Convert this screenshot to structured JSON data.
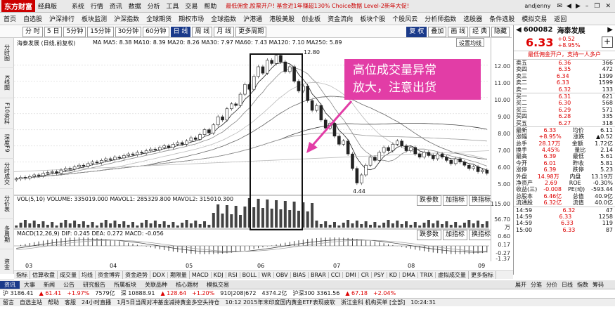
{
  "titlebar": {
    "logo": "东方财富",
    "edition": "经典版",
    "menus": [
      "系统",
      "行情",
      "资讯",
      "数据",
      "分析",
      "工具",
      "交易",
      "帮助"
    ],
    "ticker": "最低佣金,股票开户! 基金近1年赚超130% Choice数据 Level-2新年大促!",
    "user": "andjenny"
  },
  "navbar": {
    "items": [
      "首页",
      "自选股",
      "沪深排行",
      "板块监测",
      "沪深指数",
      "全球期货",
      "期权市场",
      "全球指数",
      "沪港通",
      "港股美股",
      "创业板",
      "资金流向",
      "板块个股",
      "个股风云",
      "分析师指数",
      "选股器",
      "条件选股",
      "模拟交易",
      "返回"
    ]
  },
  "ctrl": {
    "periods": [
      "分 时",
      "5 日",
      "5分钟",
      "15分钟",
      "30分钟",
      "60分钟",
      "日 线",
      "周 线",
      "月 线",
      "更多周期"
    ],
    "active": "日 线",
    "tools": [
      "复 权",
      "叠加",
      "画 线",
      "经 典",
      "隐藏"
    ]
  },
  "side": [
    "分时图",
    "K线图",
    "F10资料",
    "深度F9",
    "分时成交",
    "分价表",
    "多周期",
    "资金",
    "席位"
  ],
  "chart": {
    "title": "海泰发展 (日线,前复权)",
    "ma_line": "MA  MA5: 8.38  MA10: 8.39  MA20: 8.26  MA30: 7.97  MA60: 7.43  MA120: 7.10  MA250: 5.89",
    "setting": "设置均线",
    "high_label": "12.80",
    "low_label": "4.44",
    "price_axis": [
      "12.00",
      "11.00",
      "10.00",
      "9.00",
      "8.00",
      "7.00",
      "6.00",
      "5.00"
    ],
    "vol_line": "VOL(5,10) VOLUME: 335019.000  MAVOL1: 285329.800  MAVOL2: 315010.300",
    "vol_axis": [
      "115.00",
      "56.70",
      "万"
    ],
    "macd_line": "MACD(12,26,9)  DIF: 0.245  DEA: 0.272  MACD: -0.056",
    "macd_axis": [
      "0.60",
      "0.17",
      "-0.27",
      "-1.37"
    ],
    "macd_lower_axis": "x0.1",
    "buttons": [
      "跌参数",
      "加指标",
      "换指标"
    ],
    "dates": [
      "03",
      "04",
      "05",
      "06",
      "07",
      "08",
      "09"
    ],
    "chart_data": {
      "type": "candlestick",
      "title": "海泰发展 (日线,前复权)",
      "ylim": [
        4.2,
        12.9
      ],
      "series_ma": [
        "MA5",
        "MA10",
        "MA20",
        "MA30",
        "MA60",
        "MA120",
        "MA250"
      ],
      "annotations": [
        "12.80",
        "4.44"
      ],
      "candles": [
        [
          4.9,
          4.95
        ],
        [
          4.95,
          5.05
        ],
        [
          5.05,
          5.0
        ],
        [
          5.0,
          5.1
        ],
        [
          5.1,
          5.2
        ],
        [
          5.2,
          5.15
        ],
        [
          5.15,
          5.3
        ],
        [
          5.3,
          5.35
        ],
        [
          5.35,
          5.4
        ],
        [
          5.4,
          5.3
        ],
        [
          5.3,
          5.5
        ],
        [
          5.5,
          5.6
        ],
        [
          5.6,
          5.55
        ],
        [
          5.55,
          5.7
        ],
        [
          5.7,
          5.8
        ],
        [
          5.8,
          5.75
        ],
        [
          5.75,
          5.9
        ],
        [
          5.9,
          6.0
        ],
        [
          6.0,
          5.95
        ],
        [
          5.95,
          6.1
        ],
        [
          6.1,
          6.2
        ],
        [
          6.2,
          6.15
        ],
        [
          6.15,
          6.3
        ],
        [
          6.3,
          6.25
        ],
        [
          6.25,
          6.4
        ],
        [
          6.4,
          6.5
        ],
        [
          6.5,
          6.45
        ],
        [
          6.45,
          6.6
        ],
        [
          6.6,
          6.55
        ],
        [
          6.55,
          6.7
        ],
        [
          6.7,
          6.8
        ],
        [
          6.8,
          6.75
        ],
        [
          6.75,
          6.9
        ],
        [
          6.9,
          7.0
        ],
        [
          7.0,
          6.9
        ],
        [
          6.9,
          7.1
        ],
        [
          7.1,
          7.2
        ],
        [
          7.2,
          7.1
        ],
        [
          7.1,
          7.3
        ],
        [
          7.3,
          7.5
        ],
        [
          7.5,
          7.4
        ],
        [
          7.4,
          7.7
        ],
        [
          7.7,
          8.0
        ],
        [
          8.0,
          7.8
        ],
        [
          7.8,
          8.3
        ],
        [
          8.3,
          8.8
        ],
        [
          8.8,
          8.6
        ],
        [
          8.6,
          9.3
        ],
        [
          9.3,
          9.6
        ],
        [
          9.6,
          9.5
        ],
        [
          9.5,
          10.2
        ],
        [
          10.2,
          10.8
        ],
        [
          10.8,
          10.5
        ],
        [
          10.5,
          11.3
        ],
        [
          11.3,
          11.9
        ],
        [
          11.9,
          11.5
        ],
        [
          11.5,
          12.3
        ],
        [
          12.3,
          12.1
        ],
        [
          12.1,
          12.6
        ],
        [
          12.6,
          12.2
        ],
        [
          12.2,
          11.6
        ],
        [
          11.6,
          11.9
        ],
        [
          11.9,
          11.0
        ],
        [
          11.0,
          10.4
        ],
        [
          10.4,
          10.7
        ],
        [
          10.7,
          9.8
        ],
        [
          9.8,
          9.2
        ],
        [
          9.2,
          9.5
        ],
        [
          9.5,
          8.6
        ],
        [
          8.6,
          8.1
        ],
        [
          8.1,
          8.4
        ],
        [
          8.4,
          7.6
        ],
        [
          7.6,
          7.1
        ],
        [
          7.1,
          7.3
        ],
        [
          7.3,
          6.5
        ],
        [
          6.5,
          5.6
        ],
        [
          5.6,
          4.7
        ],
        [
          4.7,
          5.2
        ],
        [
          5.2,
          5.8
        ],
        [
          5.8,
          6.3
        ],
        [
          6.3,
          6.1
        ],
        [
          6.1,
          6.6
        ],
        [
          6.6,
          6.9
        ],
        [
          6.9,
          6.7
        ],
        [
          6.7,
          7.1
        ],
        [
          7.1,
          7.3
        ],
        [
          7.3,
          7.0
        ],
        [
          7.0,
          6.7
        ],
        [
          6.7,
          6.9
        ],
        [
          6.9,
          6.5
        ],
        [
          6.5,
          6.3
        ],
        [
          6.3,
          6.6
        ],
        [
          6.6,
          6.4
        ],
        [
          6.4,
          6.2
        ],
        [
          6.2,
          6.5
        ],
        [
          6.5,
          6.3
        ],
        [
          6.3,
          6.1
        ],
        [
          6.1,
          5.9
        ],
        [
          5.9,
          6.2
        ],
        [
          6.2,
          6.0
        ],
        [
          6.0,
          5.8
        ],
        [
          5.8,
          5.6
        ],
        [
          5.6,
          5.7
        ],
        [
          5.7,
          5.4
        ],
        [
          5.4,
          5.5
        ],
        [
          5.5,
          5.3
        ]
      ]
    }
  },
  "callout": [
    "高位成交量异常",
    "放大，注意出货"
  ],
  "quote": {
    "code": "600082",
    "name": "海泰发展",
    "price": "6.33",
    "change": "+0.52",
    "pct": "+8.95%",
    "ad": "最低佣金开户，支持一人多户",
    "sell": [
      [
        "卖五",
        "6.36",
        "366"
      ],
      [
        "卖四",
        "6.35",
        "472"
      ],
      [
        "卖三",
        "6.34",
        "1399"
      ],
      [
        "卖二",
        "6.33",
        "1599"
      ],
      [
        "卖一",
        "6.32",
        "133",
        "+133"
      ]
    ],
    "buy": [
      [
        "买一",
        "6.31",
        "621",
        "+621"
      ],
      [
        "买二",
        "6.30",
        "568"
      ],
      [
        "买三",
        "6.29",
        "571"
      ],
      [
        "买四",
        "6.28",
        "335"
      ],
      [
        "买五",
        "6.27",
        "318"
      ]
    ],
    "stats": [
      [
        "最新",
        "6.33",
        "均价",
        "6.11"
      ],
      [
        "涨幅",
        "+8.95%",
        "涨跌",
        "▲0.52"
      ],
      [
        "总手",
        "28.17万",
        "金额",
        "1.72亿"
      ],
      [
        "换手",
        "4.45%",
        "量比",
        "2.14"
      ],
      [
        "最高",
        "6.39",
        "最低",
        "5.61"
      ],
      [
        "今开",
        "6.01",
        "昨收",
        "5.81"
      ],
      [
        "涨停",
        "6.39",
        "跌停",
        "5.23"
      ],
      [
        "外盘",
        "14.98万",
        "内盘",
        "13.19万"
      ],
      [
        "净资产",
        "2.69",
        "ROE",
        "-0.30%"
      ],
      [
        "收益(三)",
        "-0.008",
        "PE(动)",
        "-593.44"
      ],
      [
        "总股本",
        "6.46亿",
        "总值",
        "40.9亿"
      ],
      [
        "流通股",
        "6.32亿",
        "流值",
        "40.0亿"
      ]
    ],
    "ticks": [
      [
        "14:59",
        "6.32",
        "47"
      ],
      [
        "14:59",
        "6.33",
        "1258"
      ],
      [
        "14:59",
        "6.33",
        "119"
      ],
      [
        "15:00",
        "6.33",
        "87"
      ]
    ]
  },
  "tabs1": [
    "指标",
    "估算收盘",
    "成交量",
    "均线",
    "资金博弈",
    "资金趋势",
    "DDX",
    "期限量",
    "MACD",
    "KDJ",
    "RSI",
    "BOLL",
    "WR",
    "OBV",
    "BIAS",
    "BRAR",
    "CCI",
    "DMI",
    "CR",
    "PSY",
    "KD",
    "DMA",
    "TRIX",
    "虚拟成交量",
    "更多指标"
  ],
  "tabs2": [
    "资讯",
    "大事",
    "新闻",
    "公告",
    "研究报告",
    "所属板块",
    "关联品种",
    "核心题材",
    "模拟交易"
  ],
  "rtabs": [
    "展开",
    "分笔",
    "分价",
    "日线",
    "指数",
    "筹码"
  ],
  "idx": [
    "沪 3186.41",
    "▲ 61.41",
    "+1.97%",
    "7579亿",
    "深 10888.91",
    "▲ 128.64",
    "+1.20%",
    "910|208|672",
    "4374.2亿",
    "沪深300 3361.56",
    "▲ 67.18",
    "+2.04%"
  ],
  "status": [
    "留言",
    "自选主站",
    "帮助",
    "客服",
    "24小时直播",
    "1月5日当周对冲基金减持黄金多空头持仓",
    "10:12 2015年末印度国内黄金ETF表现疲软",
    "浙江金科 机构买单 [全部]",
    "10:24:31"
  ]
}
